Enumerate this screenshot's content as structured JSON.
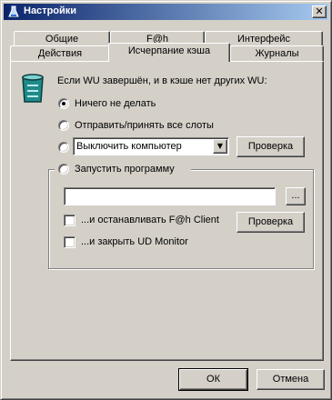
{
  "window": {
    "title": "Настройки",
    "close_glyph": "✕"
  },
  "tabs": {
    "row_back": [
      "Общие",
      "F@h",
      "Интерфейс"
    ],
    "row_front": [
      "Действия",
      "Исчерпание кэша",
      "Журналы"
    ]
  },
  "panel": {
    "intro": "Если WU завершён, и в кэше нет других WU:",
    "options": {
      "do_nothing": "Ничего не делать",
      "send_receive": "Отправить/принять все слоты",
      "run_program": "Запустить программу"
    },
    "selected_option": "do_nothing",
    "action_select": {
      "value": "Выключить компьютер",
      "arrow": "▼"
    },
    "check_button_label": "Проверка",
    "program_path": {
      "value": "",
      "browse_label": "..."
    },
    "stop_client_label": "...и останавливать F@h Client",
    "stop_client_checked": false,
    "close_monitor_label": "...и закрыть UD Monitor",
    "close_monitor_checked": false
  },
  "footer": {
    "ok_label": "ОК",
    "cancel_label": "Отмена"
  },
  "colors": {
    "face": "#d4d0c8",
    "title_from": "#0a246a",
    "title_to": "#a6caf0",
    "icon_teal": "#1f8a8a"
  }
}
